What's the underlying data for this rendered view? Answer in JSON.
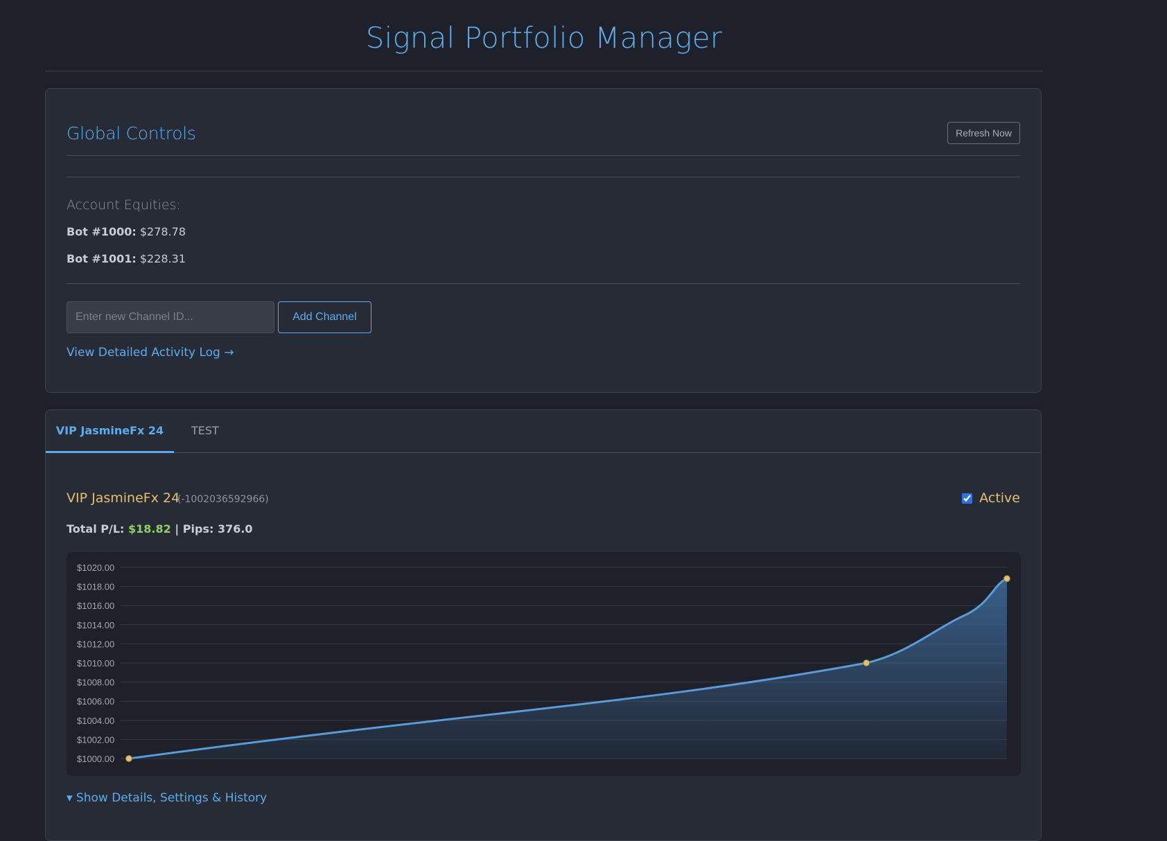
{
  "app": {
    "title": "Signal Portfolio Manager"
  },
  "controls": {
    "title": "Global Controls",
    "refresh_label": "Refresh Now",
    "equities_label": "Account Equities:",
    "equities": [
      {
        "bot": "Bot #1000:",
        "value": "$278.78"
      },
      {
        "bot": "Bot #1001:",
        "value": "$228.31"
      }
    ],
    "channel_input_placeholder": "Enter new Channel ID...",
    "add_channel_label": "Add Channel",
    "log_link": "View Detailed Activity Log →"
  },
  "tabs": [
    {
      "label": "VIP JasmineFx 24",
      "active": true
    },
    {
      "label": "TEST",
      "active": false
    }
  ],
  "channel": {
    "name": "VIP JasmineFx 24",
    "id": "(-1002036592966)",
    "active_label": "Active",
    "active": true,
    "pl_label": "Total P/L:",
    "pl_value": "$18.82",
    "separator": "|",
    "pips_label": "Pips:",
    "pips_value": "376.0",
    "details_toggle": "▾ Show Details, Settings & History"
  },
  "chart_data": {
    "type": "area",
    "x": [
      0,
      1,
      2
    ],
    "values": [
      1000.0,
      1010.0,
      1018.82
    ],
    "ylim": [
      1000,
      1020
    ],
    "yticks": [
      "$1020.00",
      "$1018.00",
      "$1016.00",
      "$1014.00",
      "$1012.00",
      "$1010.00",
      "$1008.00",
      "$1006.00",
      "$1004.00",
      "$1002.00",
      "$1000.00"
    ],
    "grid": true,
    "colors": {
      "line": "#5a9bd8",
      "point": "#e3c06e",
      "fill_top": "#3d6a99",
      "grid": "#363b46",
      "tick": "#a3a8b2"
    }
  }
}
